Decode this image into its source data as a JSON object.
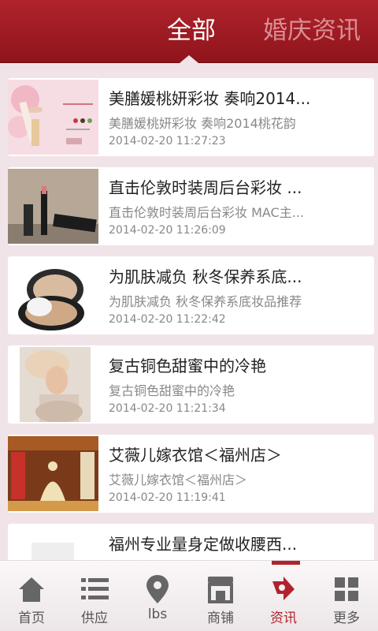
{
  "header": {
    "tab_all": "全部",
    "tab_wedding": "婚庆资讯"
  },
  "articles": [
    {
      "title": "美膳媛桃妍彩妆 奏响2014...",
      "summary": "美膳媛桃妍彩妆 奏响2014桃花韵",
      "time": "2014-02-20 11:27:23"
    },
    {
      "title": "直击伦敦时装周后台彩妆 ...",
      "summary": "直击伦敦时装周后台彩妆 MAC主...",
      "time": "2014-02-20 11:26:09"
    },
    {
      "title": "为肌肤减负 秋冬保养系底...",
      "summary": "为肌肤减负 秋冬保养系底妆品推荐",
      "time": "2014-02-20 11:22:42"
    },
    {
      "title": "复古铜色甜蜜中的冷艳",
      "summary": "复古铜色甜蜜中的冷艳",
      "time": "2014-02-20 11:21:34"
    },
    {
      "title": "艾薇儿嫁衣馆＜福州店＞",
      "summary": "艾薇儿嫁衣馆＜福州店＞",
      "time": "2014-02-20 11:19:41"
    },
    {
      "title": "福州专业量身定做收腰西...",
      "summary": "",
      "time": ""
    }
  ],
  "bottom_nav": [
    {
      "label": "首页",
      "icon": "home-icon"
    },
    {
      "label": "供应",
      "icon": "list-icon"
    },
    {
      "label": "lbs",
      "icon": "location-pin-icon"
    },
    {
      "label": "商铺",
      "icon": "store-icon"
    },
    {
      "label": "资讯",
      "icon": "news-icon"
    },
    {
      "label": "更多",
      "icon": "grid-icon"
    }
  ],
  "colors": {
    "accent": "#b0232c",
    "background": "#f1e4e8"
  }
}
